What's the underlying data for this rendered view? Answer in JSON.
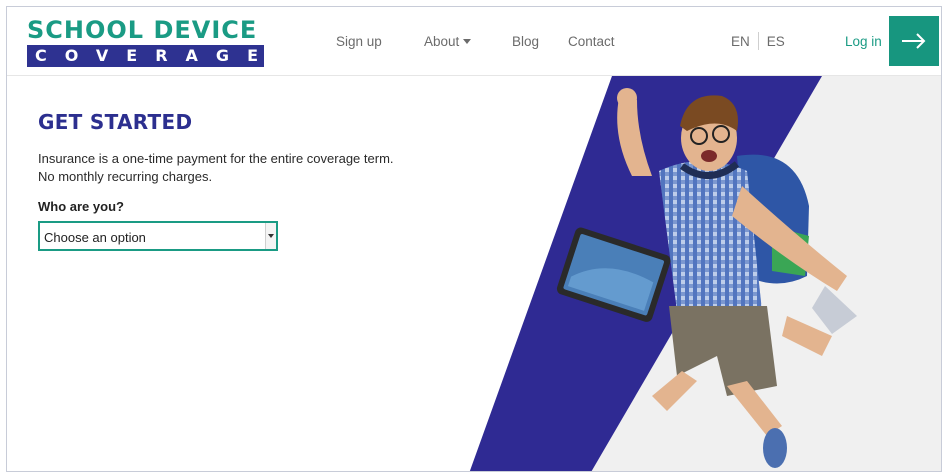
{
  "brand": {
    "line1": "SCHOOL DEVICE",
    "line2": "COVERAGE"
  },
  "nav": {
    "signup": "Sign up",
    "about": "About",
    "blog": "Blog",
    "contact": "Contact"
  },
  "lang": {
    "en": "EN",
    "es": "ES"
  },
  "login": {
    "label": "Log in"
  },
  "main": {
    "title": "GET STARTED",
    "desc_line1": "Insurance is a one-time payment for the entire coverage term.",
    "desc_line2": "No monthly recurring charges.",
    "question": "Who are you?",
    "select_value": "Choose an option"
  },
  "colors": {
    "brand_green": "#1a9b84",
    "brand_navy": "#2e3291",
    "title_navy": "#2c2f8f"
  },
  "icons": {
    "login_arrow": "arrow-right-icon",
    "about_caret": "caret-down-icon"
  }
}
